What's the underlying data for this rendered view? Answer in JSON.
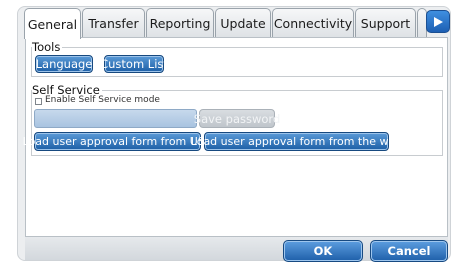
{
  "tabs": [
    {
      "label": "General",
      "active": true
    },
    {
      "label": "Transfer",
      "active": false
    },
    {
      "label": "Reporting",
      "active": false
    },
    {
      "label": "Update",
      "active": false
    },
    {
      "label": "Connectivity",
      "active": false
    },
    {
      "label": "Support",
      "active": false
    }
  ],
  "tools": {
    "title": "Tools",
    "language_label": "Language",
    "custom_list_label": "Custom List"
  },
  "self_service": {
    "title": "Self Service",
    "enable_label": "Enable Self Service mode",
    "enable_checked": false,
    "password_value": "",
    "save_password_label": "Save password",
    "load_usb_label": "Load user approval form from USB",
    "load_web_label": "Load user approval form from the web"
  },
  "footer": {
    "ok_label": "OK",
    "cancel_label": "Cancel"
  },
  "icons": {
    "tab_scroll": "play-right-icon"
  },
  "colors": {
    "accent_blue": "#1d5fa6",
    "disabled_gray": "#c9ced3"
  }
}
